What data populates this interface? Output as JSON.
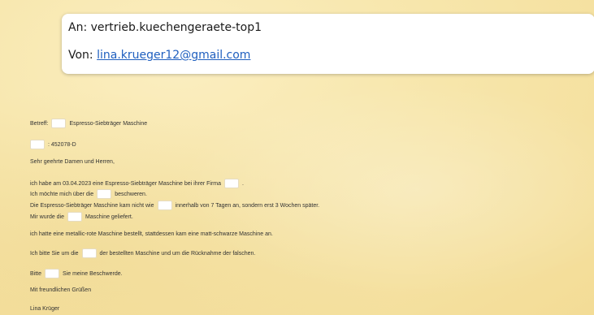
{
  "header": {
    "to_label": "An: ",
    "to_value": "vertrieb.kuechengeraete-top1",
    "from_label": "Von: ",
    "from_value": "lina.krueger12@gmail.com"
  },
  "letter": {
    "subject_prefix": "Betreff:",
    "subject_text": "Espresso-Siebträger Maschine",
    "order_number": ": 452078-D",
    "salutation": "Sehr geehrte Damen und Herren,",
    "p1_a": "ich habe am 03.04.2023 eine Espresso-Siebträger Maschine bei ihrer Firma",
    "p1_b": ".",
    "p2_a": "Ich möchte mich über die",
    "p2_b": "beschweren.",
    "p3_a": "Die Espresso-Siebträger Maschine kam nicht wie",
    "p3_b": "innerhalb von 7 Tagen an, sondern erst 3 Wochen später.",
    "p4_a": "Mir wurde die",
    "p4_b": "Maschine geliefert.",
    "p5": "ich hatte eine metallic-rote Maschine bestellt, stattdessen kam eine matt-schwarze Maschine an.",
    "p6_a": "Ich bitte Sie um die",
    "p6_b": "der bestellten Maschine und um die Rücknahme der falschen.",
    "p7_a": "Bitte",
    "p7_b": "Sie meine Beschwerde.",
    "closing": "Mit freundlichen Grüßen",
    "signature": "Lina Krüger"
  }
}
